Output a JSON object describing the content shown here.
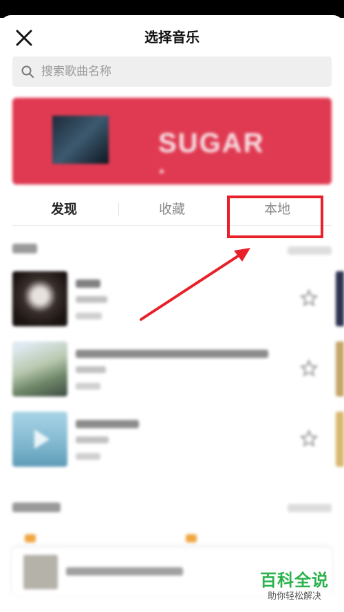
{
  "header": {
    "title": "选择音乐",
    "close_icon": "close-icon"
  },
  "search": {
    "placeholder": "搜索歌曲名称",
    "icon": "search-icon"
  },
  "banner": {
    "text": "SUGAR"
  },
  "tabs": [
    {
      "label": "发现",
      "active": true
    },
    {
      "label": "收藏",
      "active": false
    },
    {
      "label": "本地",
      "active": false
    }
  ],
  "annotation": {
    "highlight_color": "#e8202a"
  },
  "watermark": {
    "main": "百科全说",
    "sub": "助你轻松解决"
  },
  "colors": {
    "banner": "#e03a52",
    "watermark": "#2bb24c"
  }
}
